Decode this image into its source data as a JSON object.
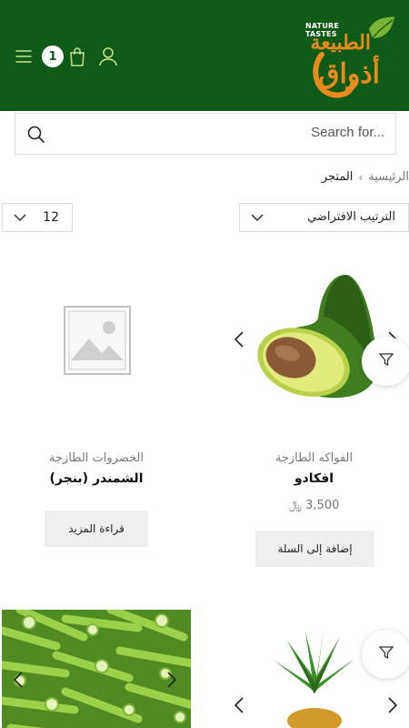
{
  "header": {
    "cart_count": "1",
    "logo": {
      "tagline": "NATURE TASTES",
      "arabic_line1": "الطبيعة",
      "arabic_line2": "أذواق"
    },
    "colors": {
      "background": "#0e5a17",
      "logo_orange": "#e98a1c",
      "logo_leaf": "#7bb534"
    }
  },
  "search": {
    "placeholder": "Search for..."
  },
  "breadcrumb": {
    "home": "الرئيسية",
    "separator": "›",
    "current": "المتجر"
  },
  "toolbar": {
    "per_page": "12",
    "order_by": "الترتيب الافتراضي"
  },
  "products": [
    {
      "category": "الفواكه الطازجة",
      "title": "افكادو",
      "price": "3,500",
      "currency": "﷼",
      "button": "إضافة إلى السلة",
      "image": "avocado"
    },
    {
      "category": "الخضروات الطازجة",
      "title": "الشمندر (بنجر)",
      "button": "قراءة المزيد",
      "image": "placeholder"
    },
    {
      "image": "pineapple"
    },
    {
      "image": "okra"
    }
  ],
  "icons": {
    "menu": "hamburger-icon",
    "cart": "shopping-bag-icon",
    "account": "user-icon",
    "search": "search-icon",
    "filter": "filter-icon",
    "dropdown": "chevron-down-icon",
    "prev": "chevron-left-icon",
    "next": "chevron-right-icon"
  }
}
